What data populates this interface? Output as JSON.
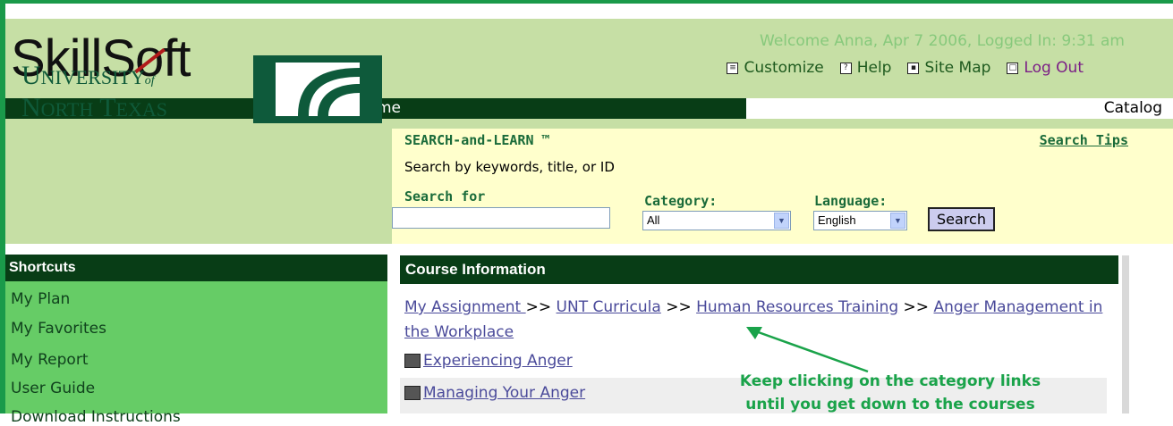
{
  "header": {
    "logo": "SkillSoft",
    "welcome": "Welcome  Anna,  Apr 7 2006,  Logged In:  9:31 am",
    "links": [
      {
        "label": "Customize",
        "icon": "customize-icon"
      },
      {
        "label": "Help",
        "icon": "help-icon"
      },
      {
        "label": "Site Map",
        "icon": "sitemap-icon"
      },
      {
        "label": "Log Out",
        "icon": "logout-icon"
      }
    ]
  },
  "nav": {
    "home": "Home",
    "catalog": "Catalog"
  },
  "branding": {
    "university_line1": "UNIVERSITYof",
    "university_line2": "NORTH TEXAS"
  },
  "search": {
    "title": "SEARCH-and-LEARN  ™",
    "tips": "Search Tips",
    "description": "Search by keywords, title, or ID",
    "search_for_label": "Search for",
    "search_for_value": "",
    "category_label": "Category:",
    "category_value": "All",
    "language_label": "Language:",
    "language_value": "English",
    "button": "Search"
  },
  "sidebar": {
    "title": "Shortcuts",
    "items": [
      "My Plan",
      "My Favorites",
      "My Report",
      "User Guide",
      "Download Instructions"
    ]
  },
  "course_info": {
    "title": "Course Information",
    "breadcrumb": [
      "My Assignment ",
      "UNT Curricula",
      "Human Resources Training",
      "Anger Management in the Workplace"
    ],
    "separator": ">>",
    "courses": [
      "Experiencing Anger",
      "Managing Your Anger"
    ]
  },
  "annotation": {
    "line1": "Keep clicking on the category links",
    "line2": "until you get down to the courses",
    "color": "#1aa34a"
  },
  "colors": {
    "header_bg": "#c6dfa5",
    "dark_green": "#083d16",
    "sidebar_bg": "#66cc66",
    "search_panel": "#ffffcc"
  }
}
